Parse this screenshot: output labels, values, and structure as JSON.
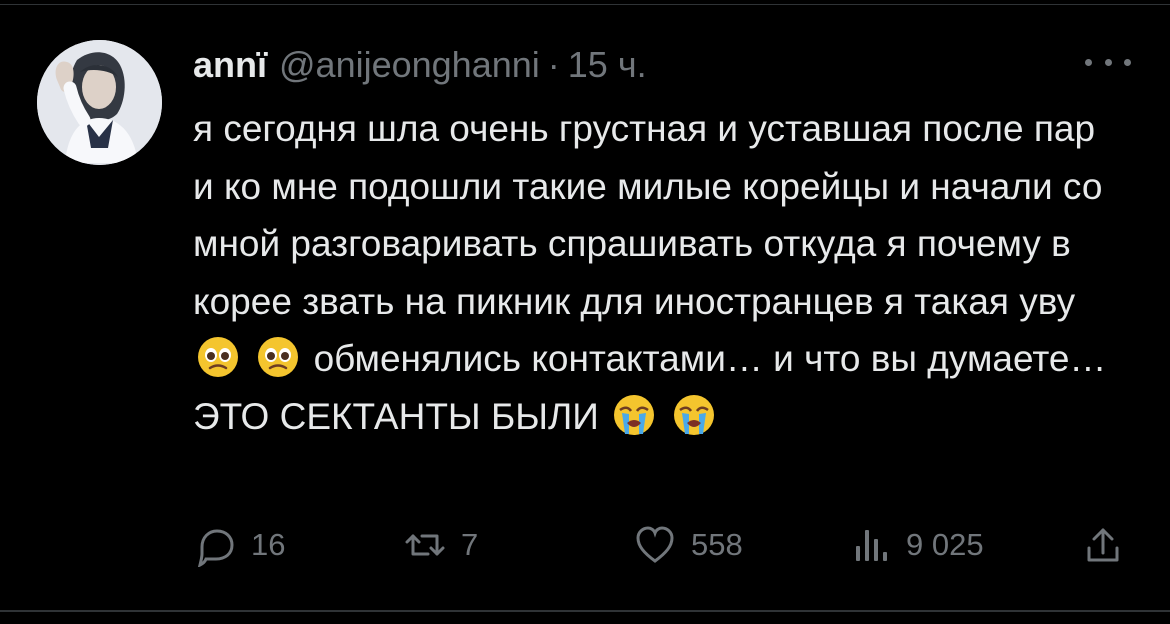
{
  "tweet": {
    "author_name": "annï",
    "handle": "@anijeonghanni",
    "separator": "·",
    "time": "15 ч.",
    "text_parts": [
      "я сегодня шла очень грустная и уставшая после пар и ко мне подошли такие милые корейцы и начали со мной разговаривать спрашивать откуда я почему в корее звать на пикник для иностранцев я такая уву",
      "обменялись контактами… и что вы думаете… ЭТО СЕКТАНТЫ БЫЛИ"
    ],
    "emojis": [
      "pleading-face",
      "pleading-face",
      "crying-face",
      "crying-face"
    ],
    "avatar_icon": "profile-photo",
    "more_icon": "more-icon"
  },
  "actions": {
    "reply": {
      "icon": "reply-icon",
      "count": "16"
    },
    "retweet": {
      "icon": "retweet-icon",
      "count": "7"
    },
    "like": {
      "icon": "heart-icon",
      "count": "558"
    },
    "views": {
      "icon": "views-icon",
      "count": "9 025"
    },
    "share": {
      "icon": "share-icon"
    }
  },
  "colors": {
    "background": "#000000",
    "primary_text": "#e7e9ea",
    "secondary_text": "#71767b",
    "divider": "#2f3336"
  }
}
